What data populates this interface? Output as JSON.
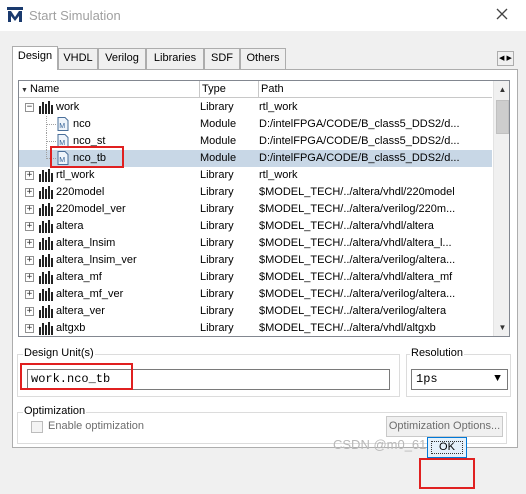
{
  "window": {
    "title": "Start Simulation"
  },
  "tabs": [
    {
      "label": "Design",
      "active": true
    },
    {
      "label": "VHDL",
      "active": false
    },
    {
      "label": "Verilog",
      "active": false
    },
    {
      "label": "Libraries",
      "active": false
    },
    {
      "label": "SDF",
      "active": false
    },
    {
      "label": "Others",
      "active": false
    }
  ],
  "tree": {
    "columns": {
      "name": "Name",
      "type": "Type",
      "path": "Path"
    },
    "rows": [
      {
        "name": "work",
        "type": "Library",
        "path": "rtl_work",
        "kind": "library",
        "expander": "−",
        "level": 0,
        "selected": false
      },
      {
        "name": "nco",
        "type": "Module",
        "path": "D:/intelFPGA/CODE/B_class5_DDS2/d...",
        "kind": "module",
        "expander": "",
        "level": 1,
        "selected": false
      },
      {
        "name": "nco_st",
        "type": "Module",
        "path": "D:/intelFPGA/CODE/B_class5_DDS2/d...",
        "kind": "module",
        "expander": "",
        "level": 1,
        "selected": false
      },
      {
        "name": "nco_tb",
        "type": "Module",
        "path": "D:/intelFPGA/CODE/B_class5_DDS2/d...",
        "kind": "module",
        "expander": "",
        "level": 1,
        "selected": true
      },
      {
        "name": "rtl_work",
        "type": "Library",
        "path": "rtl_work",
        "kind": "library",
        "expander": "+",
        "level": 0,
        "selected": false
      },
      {
        "name": "220model",
        "type": "Library",
        "path": "$MODEL_TECH/../altera/vhdl/220model",
        "kind": "library",
        "expander": "+",
        "level": 0,
        "selected": false
      },
      {
        "name": "220model_ver",
        "type": "Library",
        "path": "$MODEL_TECH/../altera/verilog/220m...",
        "kind": "library",
        "expander": "+",
        "level": 0,
        "selected": false
      },
      {
        "name": "altera",
        "type": "Library",
        "path": "$MODEL_TECH/../altera/vhdl/altera",
        "kind": "library",
        "expander": "+",
        "level": 0,
        "selected": false
      },
      {
        "name": "altera_lnsim",
        "type": "Library",
        "path": "$MODEL_TECH/../altera/vhdl/altera_l...",
        "kind": "library",
        "expander": "+",
        "level": 0,
        "selected": false
      },
      {
        "name": "altera_lnsim_ver",
        "type": "Library",
        "path": "$MODEL_TECH/../altera/verilog/altera...",
        "kind": "library",
        "expander": "+",
        "level": 0,
        "selected": false
      },
      {
        "name": "altera_mf",
        "type": "Library",
        "path": "$MODEL_TECH/../altera/vhdl/altera_mf",
        "kind": "library",
        "expander": "+",
        "level": 0,
        "selected": false
      },
      {
        "name": "altera_mf_ver",
        "type": "Library",
        "path": "$MODEL_TECH/../altera/verilog/altera...",
        "kind": "library",
        "expander": "+",
        "level": 0,
        "selected": false
      },
      {
        "name": "altera_ver",
        "type": "Library",
        "path": "$MODEL_TECH/../altera/verilog/altera",
        "kind": "library",
        "expander": "+",
        "level": 0,
        "selected": false
      },
      {
        "name": "altgxb",
        "type": "Library",
        "path": "$MODEL_TECH/../altera/vhdl/altgxb",
        "kind": "library",
        "expander": "+",
        "level": 0,
        "selected": false
      }
    ]
  },
  "design_unit": {
    "label": "Design Unit(s)",
    "value": "work.nco_tb"
  },
  "resolution": {
    "label": "Resolution",
    "value": "1ps"
  },
  "optimization": {
    "label": "Optimization",
    "enable_label": "Enable optimization",
    "enabled": false,
    "options_button": "Optimization Options..."
  },
  "buttons": {
    "ok": "OK"
  },
  "watermark": "CSDN @m0_6177729",
  "colors": {
    "selection": "#c8d7e6",
    "highlight": "#e02020",
    "accent": "#0078d7"
  }
}
